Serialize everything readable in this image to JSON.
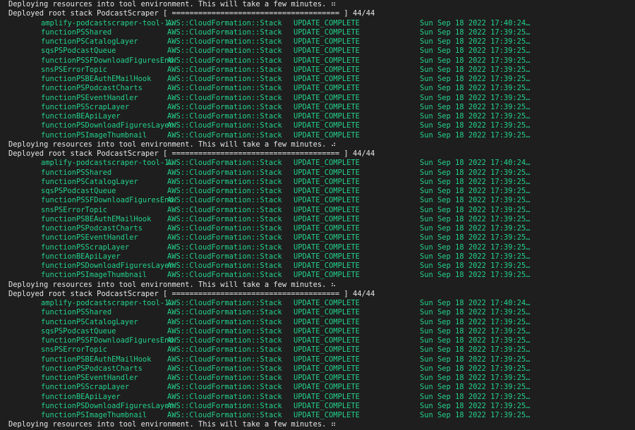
{
  "terminal": {
    "deploying_text": "Deploying resources into tool environment. This will take a few minutes.",
    "deployed_text": "Deployed root stack PodcastScraper [ ====================================== ] 44/44",
    "spinners": [
      "⠶",
      "⠴",
      "⠦",
      "⠶"
    ],
    "rows": [
      {
        "name": "amplify-podcastscraper-tool-1…",
        "type": "AWS::CloudFormation::Stack",
        "status": "UPDATE_COMPLETE",
        "time": "Sun Sep 18 2022 17:40:24…"
      },
      {
        "name": "functionPSShared",
        "type": "AWS::CloudFormation::Stack",
        "status": "UPDATE_COMPLETE",
        "time": "Sun Sep 18 2022 17:39:25…"
      },
      {
        "name": "functionPSCatalogLayer",
        "type": "AWS::CloudFormation::Stack",
        "status": "UPDATE_COMPLETE",
        "time": "Sun Sep 18 2022 17:39:25…"
      },
      {
        "name": "sqsPSPodcastQueue",
        "type": "AWS::CloudFormation::Stack",
        "status": "UPDATE_COMPLETE",
        "time": "Sun Sep 18 2022 17:39:25…"
      },
      {
        "name": "functionPSSFDownloadFiguresEnd",
        "type": "AWS::CloudFormation::Stack",
        "status": "UPDATE_COMPLETE",
        "time": "Sun Sep 18 2022 17:39:25…"
      },
      {
        "name": "snsPSErrorTopic",
        "type": "AWS::CloudFormation::Stack",
        "status": "UPDATE_COMPLETE",
        "time": "Sun Sep 18 2022 17:39:25…"
      },
      {
        "name": "functionPSBEAuthEMailHook",
        "type": "AWS::CloudFormation::Stack",
        "status": "UPDATE_COMPLETE",
        "time": "Sun Sep 18 2022 17:39:25…"
      },
      {
        "name": "functionPSPodcastCharts",
        "type": "AWS::CloudFormation::Stack",
        "status": "UPDATE_COMPLETE",
        "time": "Sun Sep 18 2022 17:39:25…"
      },
      {
        "name": "functionPSEventHandler",
        "type": "AWS::CloudFormation::Stack",
        "status": "UPDATE_COMPLETE",
        "time": "Sun Sep 18 2022 17:39:25…"
      },
      {
        "name": "functionPSScrapLayer",
        "type": "AWS::CloudFormation::Stack",
        "status": "UPDATE_COMPLETE",
        "time": "Sun Sep 18 2022 17:39:25…"
      },
      {
        "name": "functionBEApiLayer",
        "type": "AWS::CloudFormation::Stack",
        "status": "UPDATE_COMPLETE",
        "time": "Sun Sep 18 2022 17:39:25…"
      },
      {
        "name": "functionPSDownloadFiguresLayer",
        "type": "AWS::CloudFormation::Stack",
        "status": "UPDATE_COMPLETE",
        "time": "Sun Sep 18 2022 17:39:25…"
      },
      {
        "name": "functionPSImageThumbnail",
        "type": "AWS::CloudFormation::Stack",
        "status": "UPDATE_COMPLETE",
        "time": "Sun Sep 18 2022 17:39:25…"
      }
    ],
    "repeat_blocks": 3
  }
}
